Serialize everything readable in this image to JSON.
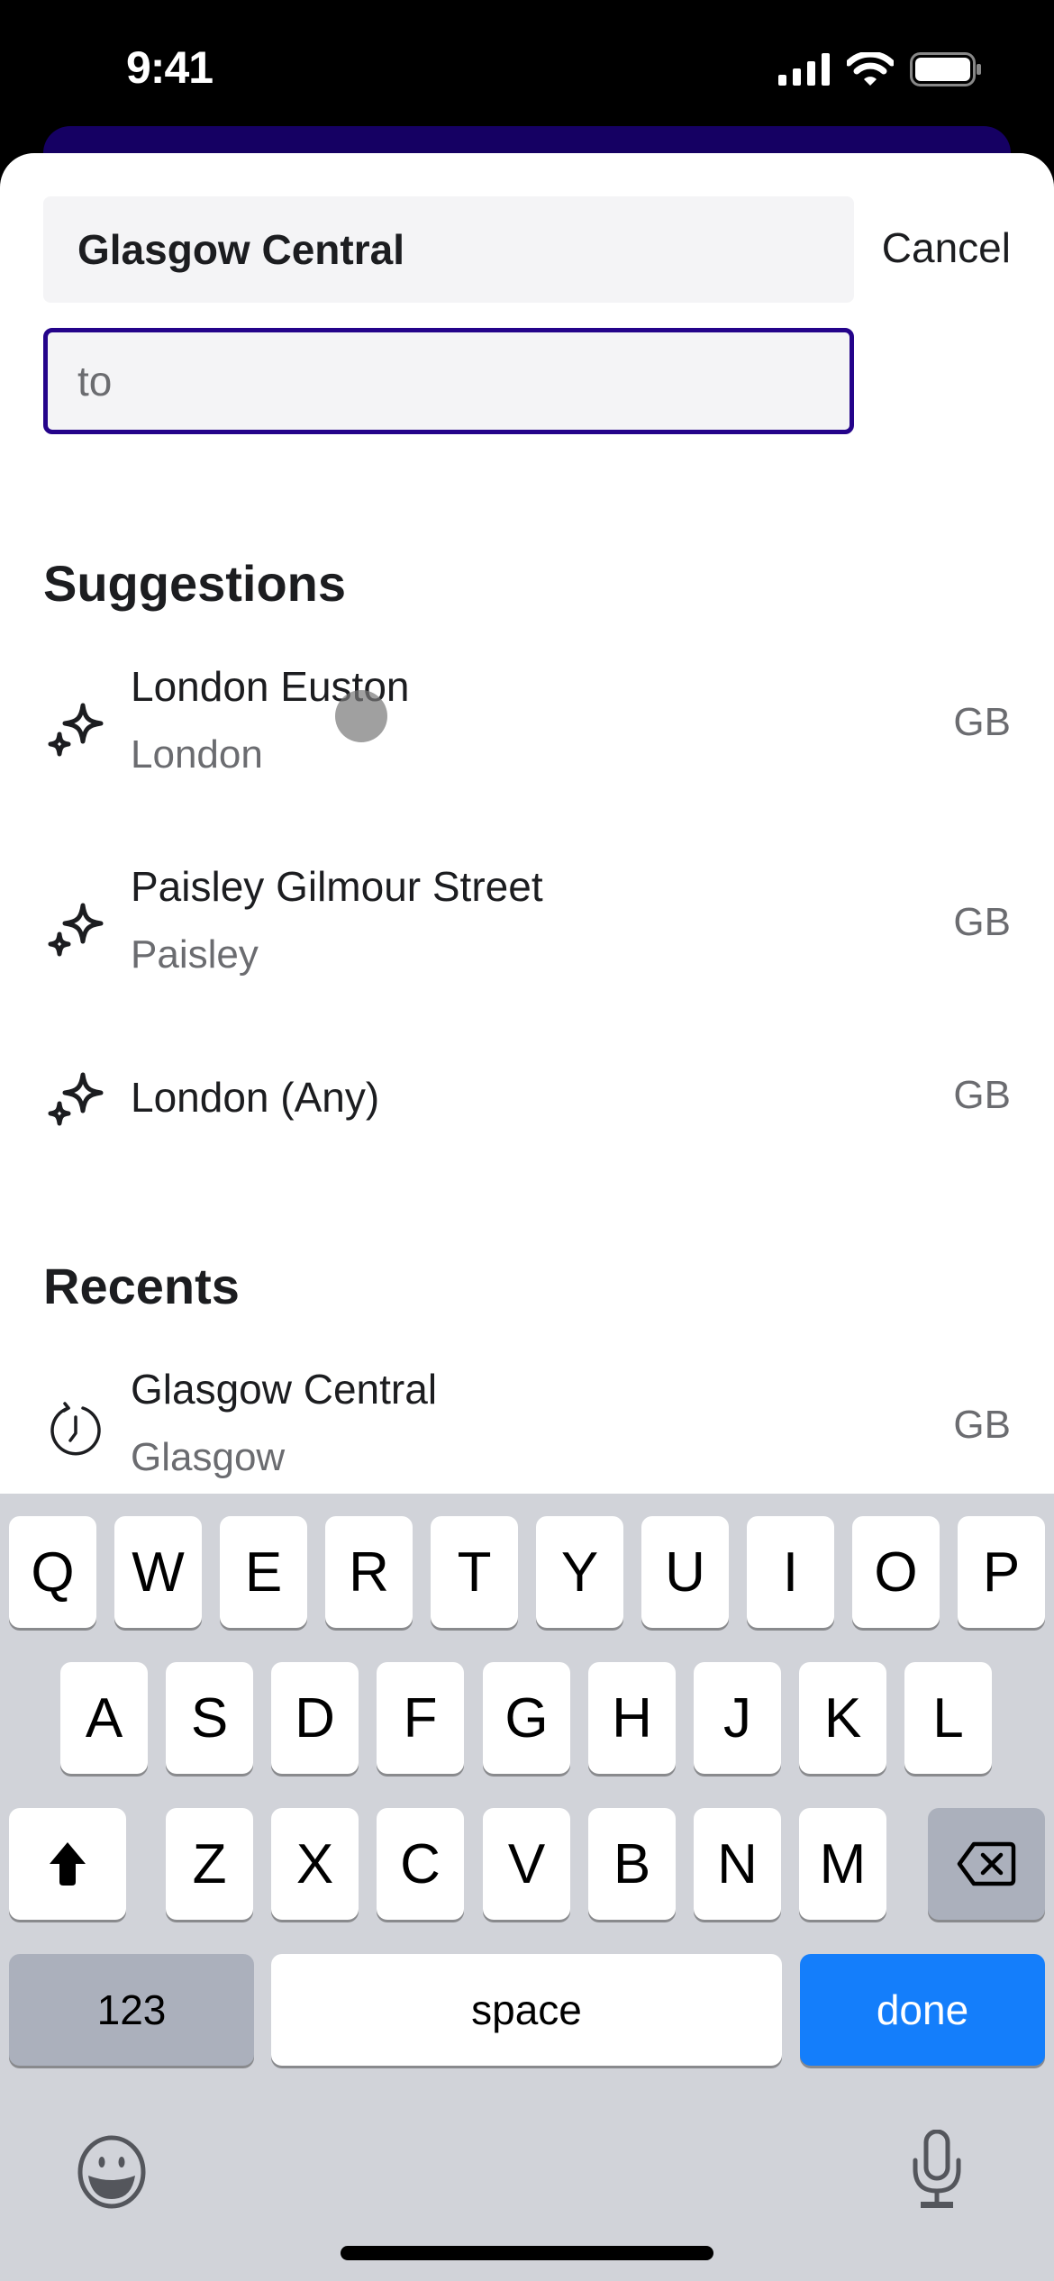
{
  "status_bar": {
    "time": "9:41",
    "icons": [
      "cellular-signal-icon",
      "wifi-icon",
      "battery-icon"
    ]
  },
  "search": {
    "from_value": "Glasgow Central",
    "to_placeholder": "to",
    "to_value": "",
    "cancel_label": "Cancel"
  },
  "suggestions": {
    "title": "Suggestions",
    "items": [
      {
        "icon": "sparkles-icon",
        "name": "London Euston",
        "sub": "London",
        "country": "GB"
      },
      {
        "icon": "sparkles-icon",
        "name": "Paisley Gilmour Street",
        "sub": "Paisley",
        "country": "GB"
      },
      {
        "icon": "sparkles-icon",
        "name": "London (Any)",
        "sub": "",
        "country": "GB"
      }
    ]
  },
  "recents": {
    "title": "Recents",
    "items": [
      {
        "icon": "history-clock-icon",
        "name": "Glasgow Central",
        "sub": "Glasgow",
        "country": "GB"
      }
    ]
  },
  "keyboard": {
    "row1": [
      "Q",
      "W",
      "E",
      "R",
      "T",
      "Y",
      "U",
      "I",
      "O",
      "P"
    ],
    "row2": [
      "A",
      "S",
      "D",
      "F",
      "G",
      "H",
      "J",
      "K",
      "L"
    ],
    "row3": [
      "Z",
      "X",
      "C",
      "V",
      "B",
      "N",
      "M"
    ],
    "numbers_label": "123",
    "space_label": "space",
    "done_label": "done"
  },
  "colors": {
    "accent": "#24038a",
    "header": "#150063",
    "done_key": "#147efb",
    "keyboard_bg": "#d1d3d9"
  }
}
